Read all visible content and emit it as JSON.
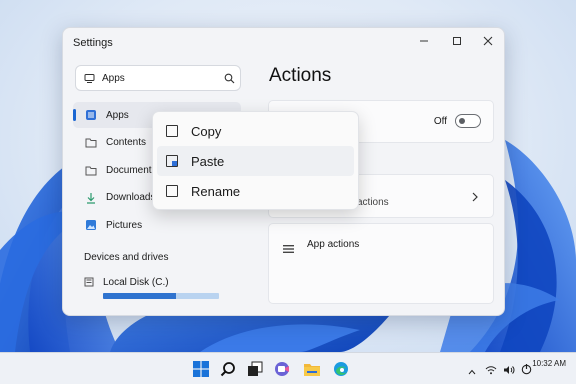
{
  "window": {
    "title": "Settings",
    "controls": [
      "minimize",
      "maximize",
      "close"
    ]
  },
  "search": {
    "value": "Apps",
    "icon": "search-icon"
  },
  "nav": {
    "items": [
      {
        "label": "Apps",
        "icon": "apps-icon",
        "active": true
      },
      {
        "label": "Contents",
        "icon": "folder-icon"
      },
      {
        "label": "Documents",
        "icon": "folder-icon"
      },
      {
        "label": "Downloads",
        "icon": "download-icon"
      },
      {
        "label": "Pictures",
        "icon": "pictures-icon"
      }
    ],
    "section_heading": "Devices and drives",
    "drive": {
      "label": "Local Disk (C.)",
      "usage_fraction": 0.63
    }
  },
  "main": {
    "title": "Actions",
    "toggle": {
      "state_label": "Off",
      "on": false
    },
    "card2_text": "actions",
    "card3_text": "App actions"
  },
  "context_menu": {
    "items": [
      {
        "label": "Copy",
        "icon": "checkbox-icon"
      },
      {
        "label": "Paste",
        "icon": "paste-icon",
        "hover": true
      },
      {
        "label": "Rename",
        "icon": "checkbox-icon"
      }
    ]
  },
  "taskbar": {
    "apps": [
      "windows-start-icon",
      "search-icon",
      "task-view-icon",
      "teams-icon",
      "file-explorer-icon",
      "edge-icon"
    ],
    "tray": [
      "chevron-up-icon",
      "wifi-icon",
      "volume-icon",
      "battery-icon"
    ],
    "time": "10:32 AM",
    "date": ""
  },
  "colors": {
    "accent": "#1a66d2",
    "bloom": "#1f63d6",
    "toggle_off": "#5c5f64"
  }
}
